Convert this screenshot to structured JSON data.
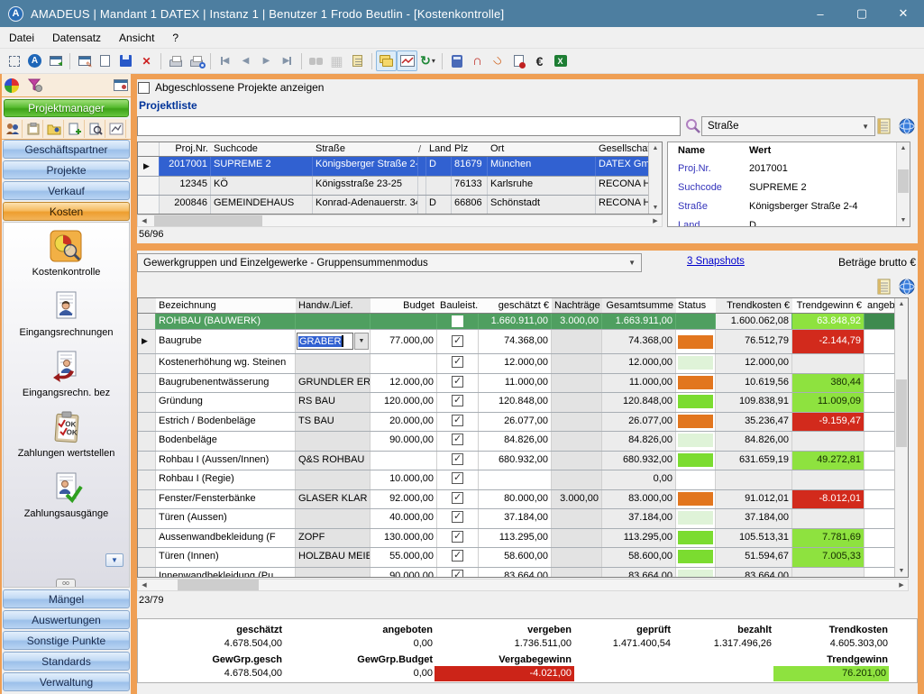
{
  "window": {
    "title": "AMADEUS | Mandant 1 DATEX | Instanz 1 | Benutzer 1 Frodo Beutlin - [Kostenkontrolle]",
    "minimize": "–",
    "maximize": "▢",
    "close": "✕"
  },
  "menu": {
    "items": [
      "Datei",
      "Datensatz",
      "Ansicht",
      "?"
    ]
  },
  "toolbar": {
    "icons": [
      "select-region",
      "amadeus-home",
      "exit",
      "form-designer",
      "new-record",
      "save",
      "delete",
      "print",
      "print-preview",
      "first-record",
      "previous-record",
      "next-record",
      "last-record",
      "search-binoculars",
      "grid-view",
      "goto-notebook",
      "copy-records",
      "chart",
      "refresh",
      "calculator",
      "magnet",
      "magnet-jump",
      "license",
      "euro",
      "excel-export"
    ]
  },
  "sidebar": {
    "group_title": "Projektmanager",
    "sections": [
      "Geschäftspartner",
      "Projekte",
      "Verkauf",
      "Kosten"
    ],
    "items": [
      "Kostenkontrolle",
      "Eingangsrechnungen",
      "Eingangsrechn. bez",
      "Zahlungen wertstellen",
      "Zahlungsausgänge"
    ],
    "bottom_sections": [
      "Mängel",
      "Auswertungen",
      "Sonstige Punkte",
      "Standards",
      "Verwaltung"
    ]
  },
  "projects": {
    "show_closed_label": "Abgeschlossene Projekte anzeigen",
    "panel_title": "Projektliste",
    "search": {
      "value": "",
      "field": "Straße"
    },
    "sort_indicator": "/",
    "columns": [
      "Proj.Nr.",
      "Suchcode",
      "Straße",
      "Land",
      "Plz",
      "Ort",
      "Gesellschaf"
    ],
    "rows": [
      {
        "nr": "2017001",
        "code": "SUPREME 2",
        "strasse": "Königsberger Straße 2-4",
        "land": "D",
        "plz": "81679",
        "ort": "München",
        "ges": "DATEX Gm",
        "sel": "on"
      },
      {
        "nr": "12345",
        "code": "KÖ",
        "strasse": "Königsstraße 23-25",
        "land": "",
        "plz": "76133",
        "ort": "Karlsruhe",
        "ges": "RECONA H",
        "sel": "off"
      },
      {
        "nr": "200846",
        "code": "GEMEINDEHAUS",
        "strasse": "Konrad-Adenauerstr. 34",
        "land": "D",
        "plz": "66806",
        "ort": "Schönstadt",
        "ges": "RECONA H",
        "sel": "off"
      }
    ],
    "record_count": "56/96",
    "details": {
      "columns": [
        "Name",
        "Wert"
      ],
      "rows": [
        {
          "name": "Proj.Nr.",
          "wert": "2017001"
        },
        {
          "name": "Suchcode",
          "wert": "SUPREME 2"
        },
        {
          "name": "Straße",
          "wert": "Königsberger Straße 2-4"
        },
        {
          "name": "Land",
          "wert": "D"
        }
      ]
    }
  },
  "costs": {
    "mode_selector": "Gewerkgruppen und Einzelgewerke - Gruppensummenmodus",
    "snapshots_link": "3 Snapshots",
    "amount_label": "Beträge brutto €",
    "columns": [
      "Bezeichnung",
      "Handw./Lief.",
      "Budget",
      "Bauleist.?",
      "geschätzt €",
      "Nachträge",
      "Gesamtsumme",
      "Status",
      "Trendkosten €",
      "Trendgewinn €",
      "angebot"
    ],
    "rows": [
      {
        "bez": "ROHBAU (BAUWERK)",
        "hw": "",
        "budget": "",
        "chk": "off",
        "gesch": "1.660.911,00",
        "nt": "3.000,00",
        "gesamt": "1.663.911,00",
        "status": "none",
        "tk": "1.600.062,08",
        "tg": "63.848,92",
        "tg_state": "pos"
      },
      {
        "bez": "Baugrube",
        "hw": "GRABER",
        "budget": "77.000,00",
        "chk": "on",
        "gesch": "74.368,00",
        "nt": "",
        "gesamt": "74.368,00",
        "status": "orange",
        "tk": "76.512,79",
        "tg": "-2.144,79",
        "tg_state": "neg"
      },
      {
        "bez": "Kostenerhöhung wg. Steinen",
        "hw": "",
        "budget": "",
        "chk": "on",
        "gesch": "12.000,00",
        "nt": "",
        "gesamt": "12.000,00",
        "status": "pale",
        "tk": "12.000,00",
        "tg": "",
        "tg_state": "none"
      },
      {
        "bez": "Baugrubenentwässerung",
        "hw": "GRUNDLER ER",
        "budget": "12.000,00",
        "chk": "on",
        "gesch": "11.000,00",
        "nt": "",
        "gesamt": "11.000,00",
        "status": "orange",
        "tk": "10.619,56",
        "tg": "380,44",
        "tg_state": "pos"
      },
      {
        "bez": "Gründung",
        "hw": "RS BAU",
        "budget": "120.000,00",
        "chk": "on",
        "gesch": "120.848,00",
        "nt": "",
        "gesamt": "120.848,00",
        "status": "green",
        "tk": "109.838,91",
        "tg": "11.009,09",
        "tg_state": "pos"
      },
      {
        "bez": "Estrich / Bodenbeläge",
        "hw": "TS BAU",
        "budget": "20.000,00",
        "chk": "on",
        "gesch": "26.077,00",
        "nt": "",
        "gesamt": "26.077,00",
        "status": "orange",
        "tk": "35.236,47",
        "tg": "-9.159,47",
        "tg_state": "neg"
      },
      {
        "bez": "Bodenbeläge",
        "hw": "",
        "budget": "90.000,00",
        "chk": "on",
        "gesch": "84.826,00",
        "nt": "",
        "gesamt": "84.826,00",
        "status": "pale",
        "tk": "84.826,00",
        "tg": "",
        "tg_state": "none"
      },
      {
        "bez": "Rohbau I (Aussen/Innen)",
        "hw": "Q&S ROHBAU",
        "budget": "",
        "chk": "on",
        "gesch": "680.932,00",
        "nt": "",
        "gesamt": "680.932,00",
        "status": "green",
        "tk": "631.659,19",
        "tg": "49.272,81",
        "tg_state": "pos"
      },
      {
        "bez": "Rohbau I (Regie)",
        "hw": "",
        "budget": "10.000,00",
        "chk": "on",
        "gesch": "",
        "nt": "",
        "gesamt": "0,00",
        "status": "white",
        "tk": "",
        "tg": "",
        "tg_state": "none"
      },
      {
        "bez": "Fenster/Fensterbänke",
        "hw": "GLASER KLAR",
        "budget": "92.000,00",
        "chk": "on",
        "gesch": "80.000,00",
        "nt": "3.000,00",
        "gesamt": "83.000,00",
        "status": "orange",
        "tk": "91.012,01",
        "tg": "-8.012,01",
        "tg_state": "neg"
      },
      {
        "bez": "Türen (Aussen)",
        "hw": "",
        "budget": "40.000,00",
        "chk": "on",
        "gesch": "37.184,00",
        "nt": "",
        "gesamt": "37.184,00",
        "status": "pale",
        "tk": "37.184,00",
        "tg": "",
        "tg_state": "none"
      },
      {
        "bez": "Aussenwandbekleidung (F",
        "hw": "ZOPF",
        "budget": "130.000,00",
        "chk": "on",
        "gesch": "113.295,00",
        "nt": "",
        "gesamt": "113.295,00",
        "status": "green",
        "tk": "105.513,31",
        "tg": "7.781,69",
        "tg_state": "pos"
      },
      {
        "bez": "Türen (Innen)",
        "hw": "HOLZBAU MEIE",
        "budget": "55.000,00",
        "chk": "on",
        "gesch": "58.600,00",
        "nt": "",
        "gesamt": "58.600,00",
        "status": "green",
        "tk": "51.594,67",
        "tg": "7.005,33",
        "tg_state": "pos"
      },
      {
        "bez": "Innenwandbekleidung (Pu",
        "hw": "",
        "budget": "90.000,00",
        "chk": "on",
        "gesch": "83.664,00",
        "nt": "",
        "gesamt": "83.664,00",
        "status": "pale",
        "tk": "83.664,00",
        "tg": "",
        "tg_state": "none"
      }
    ],
    "record_count": "23/79",
    "summary": {
      "row1": [
        {
          "label": "geschätzt",
          "value": "4.678.504,00"
        },
        {
          "label": "angeboten",
          "value": "0,00"
        },
        {
          "label": "vergeben",
          "value": "1.736.511,00"
        },
        {
          "label": "geprüft",
          "value": "1.471.400,54"
        },
        {
          "label": "bezahlt",
          "value": "1.317.496,26"
        },
        {
          "label": "Trendkosten",
          "value": "4.605.303,00"
        }
      ],
      "row2": [
        {
          "label": "GewGrp.gesch",
          "value": "4.678.504,00"
        },
        {
          "label": "GewGrp.Budget",
          "value": "0,00"
        },
        {
          "label": "Vergabegewinn",
          "value": "-4.021,00"
        },
        {
          "label": "",
          "value": ""
        },
        {
          "label": "",
          "value": ""
        },
        {
          "label": "Trendgewinn",
          "value": "76.201,00"
        }
      ]
    }
  },
  "colors": {
    "titlebar": "#4d7ea0",
    "selection_blue": "#3161d1",
    "group_row_green": "#4f9f60",
    "status_orange": "#e2761e",
    "status_green": "#7bdc30",
    "status_palegreen": "#dff3d8",
    "gain_green": "#8ee23f",
    "loss_red": "#d22a1c",
    "frame_orange": "#ef9f54",
    "link_blue": "#0000cc"
  }
}
